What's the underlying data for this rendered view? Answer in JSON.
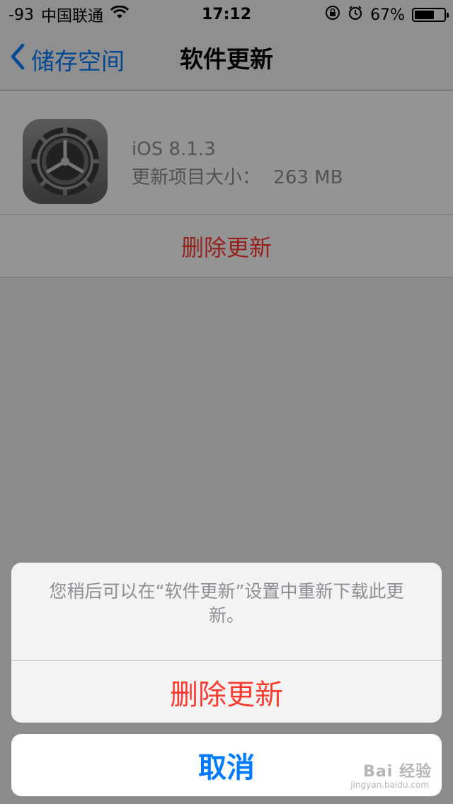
{
  "status_bar": {
    "signal": "-93",
    "carrier": "中国联通",
    "time": "17:12",
    "battery_text": "67%",
    "battery_level": 0.67
  },
  "nav": {
    "back_label": "储存空间",
    "title": "软件更新"
  },
  "update": {
    "version": "iOS 8.1.3",
    "size_label": "更新项目大小：",
    "size_value": "263 MB",
    "delete_label": "删除更新"
  },
  "action_sheet": {
    "message": "您稍后可以在“软件更新”设置中重新下载此更新。",
    "delete_label": "删除更新",
    "cancel_label": "取消"
  },
  "watermark": {
    "brand": "Bai 经验",
    "url": "jingyan.baidu.com"
  },
  "colors": {
    "accent": "#007aff",
    "destructive": "#ff3b30"
  }
}
